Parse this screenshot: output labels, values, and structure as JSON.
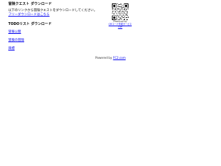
{
  "page": {
    "title": "冒険クエスト ダウンロード"
  },
  "description": {
    "line1": "以下のリンクから冒険クエストをダウンロードしてください。",
    "link": "フリーダウンロードはこちら"
  },
  "qr": {
    "caption_line1": "Produced by",
    "caption_line2": "QRコード作成サービス",
    "caption_line3": "TOP"
  },
  "section": {
    "title": "TODOリスト ダウンロード"
  },
  "nav": {
    "items": [
      {
        "label": "冒険公開"
      },
      {
        "label": "冒険の冒険"
      },
      {
        "label": "目標"
      }
    ]
  },
  "footer": {
    "prefix": "Powered by",
    "link": "FC2.com"
  }
}
